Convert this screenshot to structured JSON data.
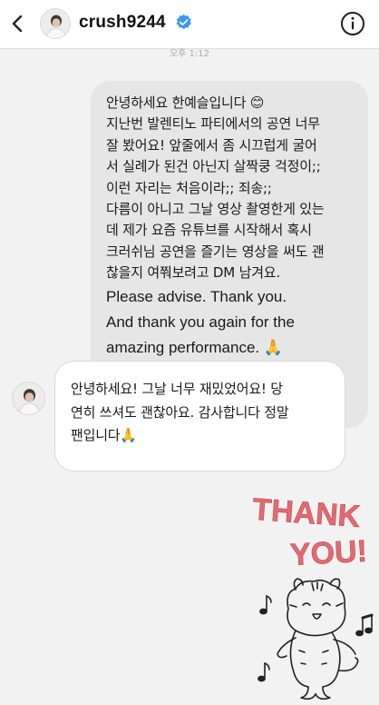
{
  "header": {
    "username": "crush9244"
  },
  "thread": {
    "timestamp": "오후 1:12",
    "sent_message": {
      "lines": [
        "안녕하세요 한예슬입니다 😊",
        "지난번 발렌티노 파티에서의 공연 너무",
        "잘 봤어요! 앞줄에서 좀 시끄럽게 굴어",
        "서 실례가 된건 아닌지 살짝쿵 걱정이;;",
        "이런 자리는 처음이라;; 죄송;;",
        "다름이 아니고 그날 영상 촬영한게 있는",
        "데 제가 요즘 유튜브를 시작해서 혹시",
        "크러쉬님 공연을 즐기는 영상을 써도 괜",
        "찮을지 여쭤보려고 DM 남겨요.",
        "Please advise. Thank you.",
        "And thank you again for the",
        "amazing performance. 🙏"
      ]
    },
    "received_message": {
      "lines": [
        "안녕하세요! 그날 너무 재밌었어요! 당",
        "연히 쓰셔도 괜찮아요. 감사합니다 정말",
        "팬입니다🙏"
      ]
    },
    "sticker": {
      "text_line1": "THANK",
      "text_line2": "YOU!",
      "text_color": "#e06b72"
    }
  },
  "icons": {
    "back": "chevron-left-icon",
    "verified": "verified-badge-icon",
    "info": "info-icon"
  },
  "colors": {
    "verified_blue": "#3897f0",
    "sent_bubble": "#e6e6e6",
    "received_bubble": "#ffffff"
  }
}
